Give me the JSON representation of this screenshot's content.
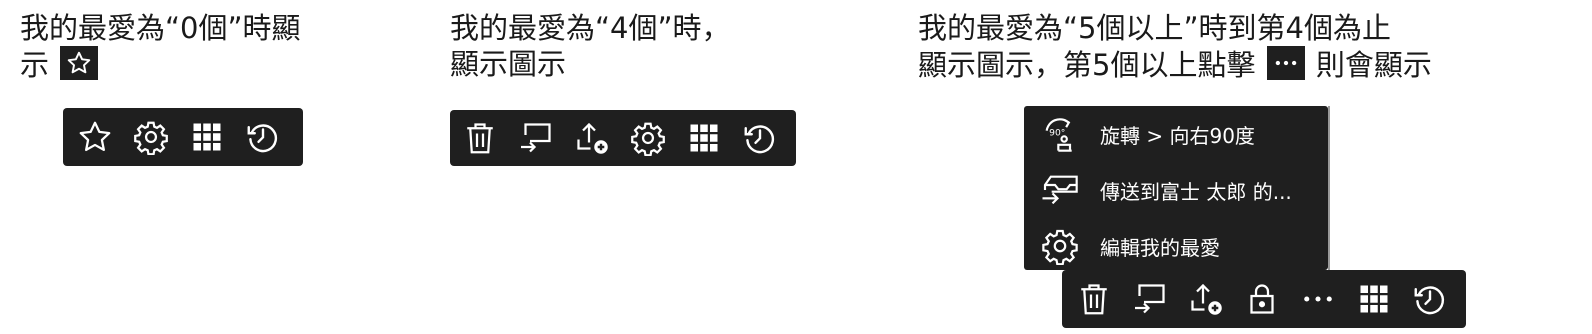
{
  "captions": {
    "col1_line1": "我的最愛為“0個”時顯",
    "col1_line2": "示",
    "col2_line1": "我的最愛為“4個”時，",
    "col2_line2": "顯示圖示",
    "col3_line1": "我的最愛為“5個以上”時到第4個為止",
    "col3_line2_a": "顯示圖示，第5個以上點擊",
    "col3_line2_b": "則會顯示"
  },
  "toolbar_zero": [
    "star-icon",
    "gear-icon",
    "grid-icon",
    "history-icon"
  ],
  "toolbar_four": [
    "trash-icon",
    "send-to-display-icon",
    "upload-add-icon",
    "gear-icon",
    "grid-icon",
    "history-icon"
  ],
  "toolbar_five": [
    "trash-icon",
    "send-to-display-icon",
    "upload-add-icon",
    "lock-icon",
    "more-icon",
    "grid-icon",
    "history-icon"
  ],
  "overflow_menu": {
    "items": [
      {
        "icon": "rotate-right-90-icon",
        "label": "旋轉 > 向右90度"
      },
      {
        "icon": "send-to-inbox-icon",
        "label": "傳送到富士 太郎 的..."
      },
      {
        "icon": "gear-icon",
        "label": "編輯我的最愛"
      }
    ],
    "rotate_badge": "90°"
  },
  "colors": {
    "toolbar_bg": "#1f1f1f",
    "icon": "#ffffff",
    "text": "#1a1a1a"
  }
}
